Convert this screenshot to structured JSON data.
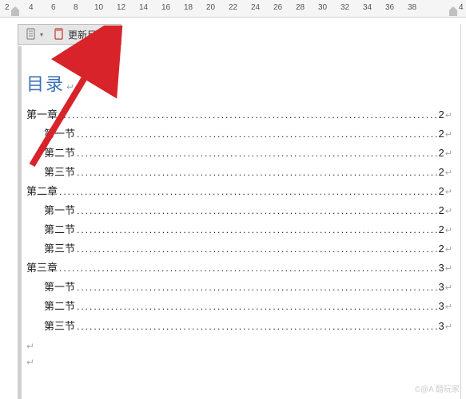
{
  "ruler": {
    "ticks": [
      "2",
      "4",
      "6",
      "8",
      "10",
      "12",
      "14",
      "16",
      "18",
      "20",
      "22",
      "24",
      "26",
      "28",
      "30",
      "32",
      "34",
      "36",
      "38",
      "4"
    ]
  },
  "toolbar": {
    "toc_options_label": "",
    "update_toc_label": "更新目录..."
  },
  "page": {
    "title": "目录",
    "entries": [
      {
        "level": 1,
        "label": "第一章",
        "page": "2"
      },
      {
        "level": 2,
        "label": "第一节",
        "page": "2"
      },
      {
        "level": 2,
        "label": "第二节",
        "page": "2"
      },
      {
        "level": 2,
        "label": "第三节",
        "page": "2"
      },
      {
        "level": 1,
        "label": "第二章",
        "page": "2"
      },
      {
        "level": 2,
        "label": "第一节",
        "page": "2"
      },
      {
        "level": 2,
        "label": "第二节",
        "page": "2"
      },
      {
        "level": 2,
        "label": "第三节",
        "page": "2"
      },
      {
        "level": 1,
        "label": "第三章",
        "page": "3"
      },
      {
        "level": 2,
        "label": "第一节",
        "page": "3"
      },
      {
        "level": 2,
        "label": "第二节",
        "page": "3"
      },
      {
        "level": 2,
        "label": "第三节",
        "page": "3"
      }
    ]
  },
  "marks": {
    "paragraph": "↵",
    "return": "↵",
    "leader": "............................................................................................................................................................................"
  },
  "watermark": "©@A 醋玩家"
}
